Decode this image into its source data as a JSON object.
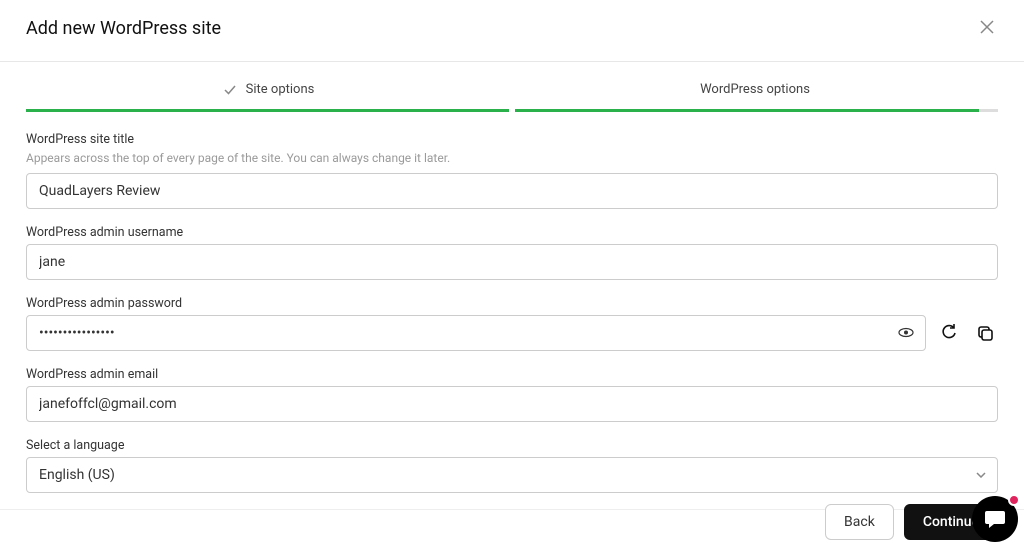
{
  "header": {
    "title": "Add new WordPress site"
  },
  "steps": {
    "step1": "Site options",
    "step2": "WordPress options"
  },
  "fields": {
    "siteTitle": {
      "label": "WordPress site title",
      "hint": "Appears across the top of every page of the site. You can always change it later.",
      "value": "QuadLayers Review"
    },
    "adminUser": {
      "label": "WordPress admin username",
      "value": "jane"
    },
    "adminPass": {
      "label": "WordPress admin password",
      "value": "••••••••••••••••"
    },
    "adminEmail": {
      "label": "WordPress admin email",
      "value": "janefoffcl@gmail.com"
    },
    "language": {
      "label": "Select a language",
      "value": "English (US)"
    }
  },
  "footer": {
    "back": "Back",
    "continue": "Continue"
  }
}
